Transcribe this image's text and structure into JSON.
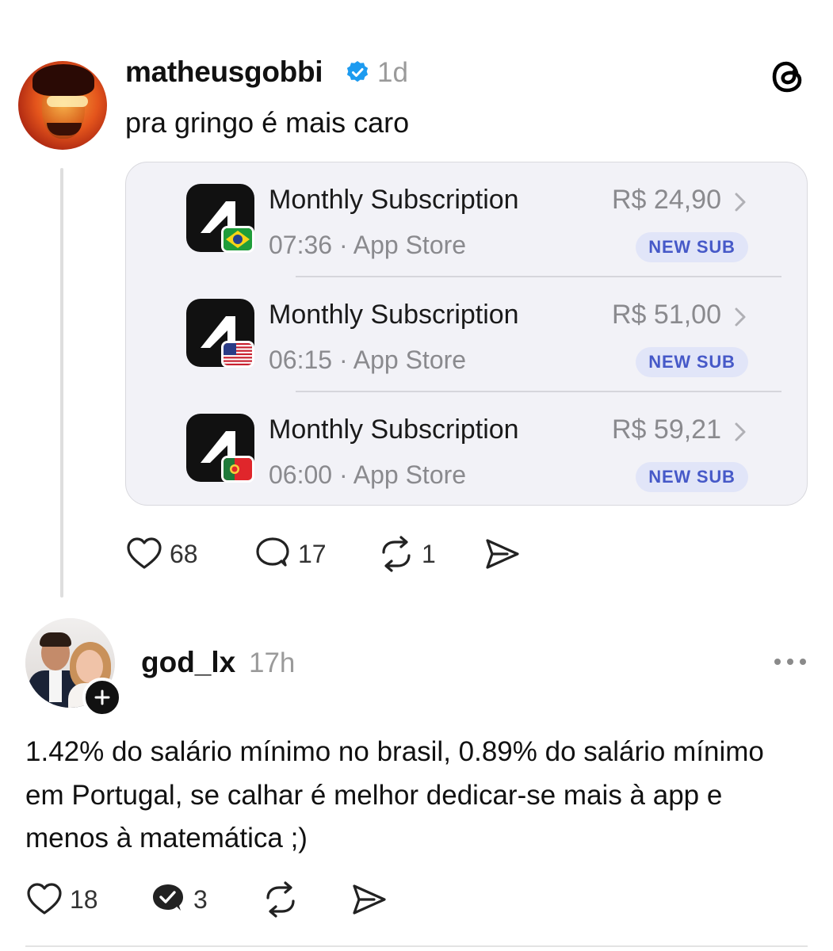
{
  "post1": {
    "username": "matheusgobbi",
    "time": "1d",
    "text": "pra gringo é mais caro",
    "subscriptions": [
      {
        "title": "Monthly Subscription",
        "time": "07:36",
        "store": "App Store",
        "meta": "07:36 · App Store",
        "price": "R$ 24,90",
        "badge": "NEW SUB",
        "flag": "brazil-flag"
      },
      {
        "title": "Monthly Subscription",
        "time": "06:15",
        "store": "App Store",
        "meta": "06:15 · App Store",
        "price": "R$ 51,00",
        "badge": "NEW SUB",
        "flag": "usa-flag"
      },
      {
        "title": "Monthly Subscription",
        "time": "06:00",
        "store": "App Store",
        "meta": "06:00 · App Store",
        "price": "R$ 59,21",
        "badge": "NEW SUB",
        "flag": "portugal-flag"
      }
    ],
    "likes": "68",
    "replies": "17",
    "reposts": "1"
  },
  "post2": {
    "username": "god_lx",
    "time": "17h",
    "text": "1.42% do salário mínimo no brasil, 0.89% do salário mínimo em Portugal, se calhar é melhor dedicar-se mais à app e menos à matemática ;)",
    "likes": "18",
    "replies": "3"
  },
  "colors": {
    "verified_blue": "#1d9bf0",
    "badge_bg": "#e1e5f8",
    "badge_text": "#4659c8",
    "muted_text": "#9a9a9a"
  },
  "icons": [
    "verified-icon",
    "threads-logo-icon",
    "heart-icon",
    "comment-icon",
    "repost-icon",
    "share-icon",
    "more-icon",
    "plus-icon",
    "chevron-right-icon"
  ]
}
